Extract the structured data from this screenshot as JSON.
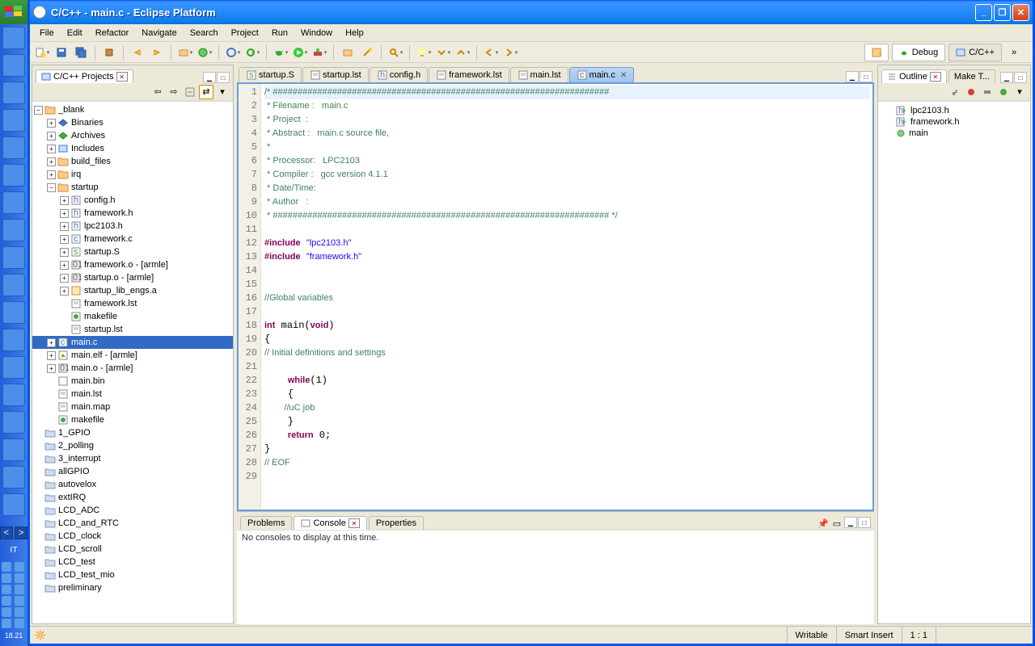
{
  "title": "C/C++ - main.c - Eclipse Platform",
  "menus": [
    "File",
    "Edit",
    "Refactor",
    "Navigate",
    "Search",
    "Project",
    "Run",
    "Window",
    "Help"
  ],
  "perspectives": {
    "debug": "Debug",
    "cpp": "C/C++"
  },
  "projects_view": {
    "title": "C/C++ Projects",
    "toolbar_icons": [
      "back-icon",
      "collapse-icon",
      "link-icon",
      "menu-icon"
    ]
  },
  "tree": [
    {
      "d": 0,
      "t": "minus",
      "i": "folder-open",
      "l": "_blank"
    },
    {
      "d": 1,
      "t": "plus",
      "i": "binaries",
      "l": "Binaries"
    },
    {
      "d": 1,
      "t": "plus",
      "i": "archives",
      "l": "Archives"
    },
    {
      "d": 1,
      "t": "plus",
      "i": "includes",
      "l": "Includes"
    },
    {
      "d": 1,
      "t": "plus",
      "i": "folder",
      "l": "build_files"
    },
    {
      "d": 1,
      "t": "plus",
      "i": "folder",
      "l": "irq"
    },
    {
      "d": 1,
      "t": "minus",
      "i": "folder-open",
      "l": "startup"
    },
    {
      "d": 2,
      "t": "plus",
      "i": "h-file",
      "l": "config.h"
    },
    {
      "d": 2,
      "t": "plus",
      "i": "h-file",
      "l": "framework.h"
    },
    {
      "d": 2,
      "t": "plus",
      "i": "h-file",
      "l": "lpc2103.h"
    },
    {
      "d": 2,
      "t": "plus",
      "i": "c-file",
      "l": "framework.c"
    },
    {
      "d": 2,
      "t": "plus",
      "i": "s-file",
      "l": "startup.S"
    },
    {
      "d": 2,
      "t": "plus",
      "i": "obj-file",
      "l": "framework.o - [armle]"
    },
    {
      "d": 2,
      "t": "plus",
      "i": "obj-file",
      "l": "startup.o - [armle]"
    },
    {
      "d": 2,
      "t": "plus",
      "i": "lib-file",
      "l": "startup_lib_engs.a"
    },
    {
      "d": 2,
      "t": "",
      "i": "txt-file",
      "l": "framework.lst"
    },
    {
      "d": 2,
      "t": "",
      "i": "makefile",
      "l": "makefile"
    },
    {
      "d": 2,
      "t": "",
      "i": "txt-file",
      "l": "startup.lst"
    },
    {
      "d": 1,
      "t": "plus",
      "i": "c-file",
      "l": "main.c",
      "sel": true
    },
    {
      "d": 1,
      "t": "plus",
      "i": "elf-file",
      "l": "main.elf - [armle]"
    },
    {
      "d": 1,
      "t": "plus",
      "i": "obj-file",
      "l": "main.o - [armle]"
    },
    {
      "d": 1,
      "t": "",
      "i": "bin-file",
      "l": "main.bin"
    },
    {
      "d": 1,
      "t": "",
      "i": "txt-file",
      "l": "main.lst"
    },
    {
      "d": 1,
      "t": "",
      "i": "txt-file",
      "l": "main.map"
    },
    {
      "d": 1,
      "t": "",
      "i": "makefile",
      "l": "makefile"
    },
    {
      "d": 0,
      "t": "",
      "i": "folder-closed",
      "l": "1_GPIO"
    },
    {
      "d": 0,
      "t": "",
      "i": "folder-closed",
      "l": "2_polling"
    },
    {
      "d": 0,
      "t": "",
      "i": "folder-closed",
      "l": "3_interrupt"
    },
    {
      "d": 0,
      "t": "",
      "i": "folder-closed",
      "l": "allGPIO"
    },
    {
      "d": 0,
      "t": "",
      "i": "folder-closed",
      "l": "autovelox"
    },
    {
      "d": 0,
      "t": "",
      "i": "folder-closed",
      "l": "extIRQ"
    },
    {
      "d": 0,
      "t": "",
      "i": "folder-closed",
      "l": "LCD_ADC"
    },
    {
      "d": 0,
      "t": "",
      "i": "folder-closed",
      "l": "LCD_and_RTC"
    },
    {
      "d": 0,
      "t": "",
      "i": "folder-closed",
      "l": "LCD_clock"
    },
    {
      "d": 0,
      "t": "",
      "i": "folder-closed",
      "l": "LCD_scroll"
    },
    {
      "d": 0,
      "t": "",
      "i": "folder-closed",
      "l": "LCD_test"
    },
    {
      "d": 0,
      "t": "",
      "i": "folder-closed",
      "l": "LCD_test_mio"
    },
    {
      "d": 0,
      "t": "",
      "i": "folder-closed",
      "l": "preliminary"
    }
  ],
  "editor_tabs": [
    {
      "i": "s-file",
      "l": "startup.S"
    },
    {
      "i": "txt-file",
      "l": "startup.lst"
    },
    {
      "i": "h-file",
      "l": "config.h"
    },
    {
      "i": "txt-file",
      "l": "framework.lst"
    },
    {
      "i": "txt-file",
      "l": "main.lst"
    },
    {
      "i": "c-file",
      "l": "main.c",
      "active": true
    }
  ],
  "code_lines": [
    {
      "n": 1,
      "cls": "comment",
      "t": "/* #################################################################### ",
      "hl": true
    },
    {
      "n": 2,
      "cls": "comment",
      "t": " * Filename :   main.c"
    },
    {
      "n": 3,
      "cls": "comment",
      "t": " * Project  :"
    },
    {
      "n": 4,
      "cls": "comment",
      "t": " * Abstract :   main.c source file,"
    },
    {
      "n": 5,
      "cls": "comment",
      "t": " *"
    },
    {
      "n": 6,
      "cls": "comment",
      "t": " * Processor:   LPC2103"
    },
    {
      "n": 7,
      "cls": "comment",
      "t": " * Compiler :   gcc version 4.1.1"
    },
    {
      "n": 8,
      "cls": "comment",
      "t": " * Date/Time:"
    },
    {
      "n": 9,
      "cls": "comment",
      "t": " * Author   :"
    },
    {
      "n": 10,
      "cls": "comment",
      "t": " * #################################################################### */"
    },
    {
      "n": 11,
      "cls": "",
      "t": ""
    },
    {
      "n": 12,
      "cls": "",
      "html": "<span class='keyword'>#include</span> <span class='string'>\"lpc2103.h\"</span>"
    },
    {
      "n": 13,
      "cls": "",
      "html": "<span class='keyword'>#include</span> <span class='string'>\"framework.h\"</span>"
    },
    {
      "n": 14,
      "cls": "",
      "t": ""
    },
    {
      "n": 15,
      "cls": "",
      "t": ""
    },
    {
      "n": 16,
      "cls": "comment",
      "t": "//Global variables"
    },
    {
      "n": 17,
      "cls": "",
      "t": ""
    },
    {
      "n": 18,
      "cls": "",
      "html": "<span class='keyword'>int</span> main(<span class='keyword'>void</span>)"
    },
    {
      "n": 19,
      "cls": "",
      "t": "{"
    },
    {
      "n": 20,
      "cls": "comment",
      "t": "// Initial definitions and settings"
    },
    {
      "n": 21,
      "cls": "",
      "t": ""
    },
    {
      "n": 22,
      "cls": "",
      "html": "    <span class='keyword'>while</span>(1)"
    },
    {
      "n": 23,
      "cls": "",
      "t": "    {"
    },
    {
      "n": 24,
      "cls": "comment",
      "t": "        //uC job"
    },
    {
      "n": 25,
      "cls": "",
      "t": "    }"
    },
    {
      "n": 26,
      "cls": "",
      "html": "    <span class='keyword'>return</span> 0;"
    },
    {
      "n": 27,
      "cls": "",
      "t": "}"
    },
    {
      "n": 28,
      "cls": "comment",
      "t": "// EOF"
    },
    {
      "n": 29,
      "cls": "",
      "t": ""
    }
  ],
  "outline": {
    "title": "Outline",
    "other_tab": "Make T...",
    "items": [
      {
        "i": "h-inc",
        "l": "lpc2103.h"
      },
      {
        "i": "h-inc",
        "l": "framework.h"
      },
      {
        "i": "func",
        "l": "main"
      }
    ]
  },
  "bottom": {
    "tabs": [
      "Problems",
      "Console",
      "Properties"
    ],
    "active": 1,
    "msg": "No consoles to display at this time."
  },
  "status": {
    "writable": "Writable",
    "insert": "Smart Insert",
    "pos": "1 : 1"
  },
  "taskbar": {
    "lang": "IT",
    "time": "18.21"
  }
}
